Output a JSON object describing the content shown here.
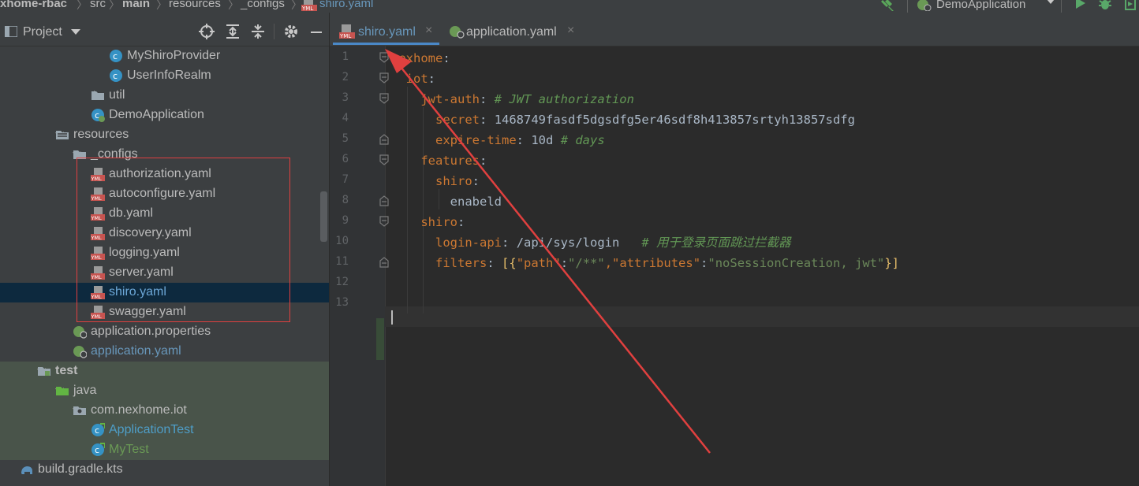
{
  "breadcrumb": {
    "items": [
      "xhome-rbac",
      "src",
      "main",
      "resources",
      "_configs",
      "shiro.yaml"
    ],
    "separator": "〉"
  },
  "run_config": {
    "label": "DemoApplication"
  },
  "project_panel": {
    "title": "Project",
    "tree": [
      {
        "label": "MyShiroProvider",
        "icon": "class-icon",
        "style": "normal"
      },
      {
        "label": "UserInfoRealm",
        "icon": "class-icon",
        "style": "normal"
      },
      {
        "label": "util",
        "icon": "folder-icon",
        "style": "normal",
        "chevron": "right"
      },
      {
        "label": "DemoApplication",
        "icon": "spring-class-icon",
        "style": "normal"
      },
      {
        "label": "resources",
        "icon": "resources-folder-icon",
        "style": "normal",
        "chevron": "down"
      },
      {
        "label": "_configs",
        "icon": "folder-icon",
        "style": "normal",
        "chevron": "down"
      },
      {
        "label": "authorization.yaml",
        "icon": "yaml-file-icon",
        "style": "normal"
      },
      {
        "label": "autoconfigure.yaml",
        "icon": "yaml-file-icon",
        "style": "normal"
      },
      {
        "label": "db.yaml",
        "icon": "yaml-file-icon",
        "style": "normal"
      },
      {
        "label": "discovery.yaml",
        "icon": "yaml-file-icon",
        "style": "normal"
      },
      {
        "label": "logging.yaml",
        "icon": "yaml-file-icon",
        "style": "normal"
      },
      {
        "label": "server.yaml",
        "icon": "yaml-file-icon",
        "style": "normal"
      },
      {
        "label": "shiro.yaml",
        "icon": "yaml-file-icon",
        "style": "selected"
      },
      {
        "label": "swagger.yaml",
        "icon": "yaml-file-icon",
        "style": "normal"
      },
      {
        "label": "application.properties",
        "icon": "spring-config-icon",
        "style": "normal"
      },
      {
        "label": "application.yaml",
        "icon": "spring-config-icon",
        "style": "blue"
      },
      {
        "label": "test",
        "icon": "test-folder-icon",
        "style": "bold",
        "chevron": "down"
      },
      {
        "label": "java",
        "icon": "test-source-folder-icon",
        "style": "normal",
        "chevron": "down"
      },
      {
        "label": "com.nexhome.iot",
        "icon": "package-icon",
        "style": "normal",
        "chevron": "down"
      },
      {
        "label": "ApplicationTest",
        "icon": "test-class-icon",
        "style": "testblue"
      },
      {
        "label": "MyTest",
        "icon": "test-class-icon",
        "style": "green"
      },
      {
        "label": "build.gradle.kts",
        "icon": "gradle-icon",
        "style": "normal"
      }
    ]
  },
  "editor": {
    "tabs": [
      {
        "label": "shiro.yaml",
        "icon": "yaml-file-icon",
        "active": true
      },
      {
        "label": "application.yaml",
        "icon": "spring-config-icon",
        "active": false
      }
    ],
    "close_glyph": "×",
    "line_numbers": [
      "1",
      "2",
      "3",
      "4",
      "5",
      "6",
      "7",
      "8",
      "9",
      "10",
      "11",
      "12",
      "13"
    ],
    "code": {
      "l1_key": "nexhome",
      "colon": ":",
      "l2_key": "iot",
      "l3_key": "jwt-auth",
      "l3_comment": "# JWT authorization",
      "l4_key": "secret",
      "l4_value": "1468749fasdf5dgsdfg5er46sdf8h413857srtyh13857sdfg",
      "l5_key": "expire-time",
      "l5_value": "10d",
      "l5_comment": "# days",
      "l6_key": "features",
      "l7_key": "shiro",
      "l8_value": "enabeld",
      "l9_key": "shiro",
      "l10_key": "login-api",
      "l10_value": "/api/sys/login",
      "l10_comment": "# 用于登录页面跳过拦截器",
      "l11_key": "filters",
      "l11_open": "[{",
      "l11_k1": "\"path\"",
      "l11_v1": "\"/**\"",
      "l11_k2": "\"attributes\"",
      "l11_v2": "\"noSessionCreation, jwt\"",
      "l11_close": "}]",
      "comma": ","
    }
  },
  "colors": {
    "panel_bg": "#3c3f41",
    "editor_bg": "#2b2b2b",
    "selected_row": "#0d293e",
    "annotation_red": "#e0403f",
    "yaml_key": "#cc7832",
    "comment": "#629755"
  }
}
